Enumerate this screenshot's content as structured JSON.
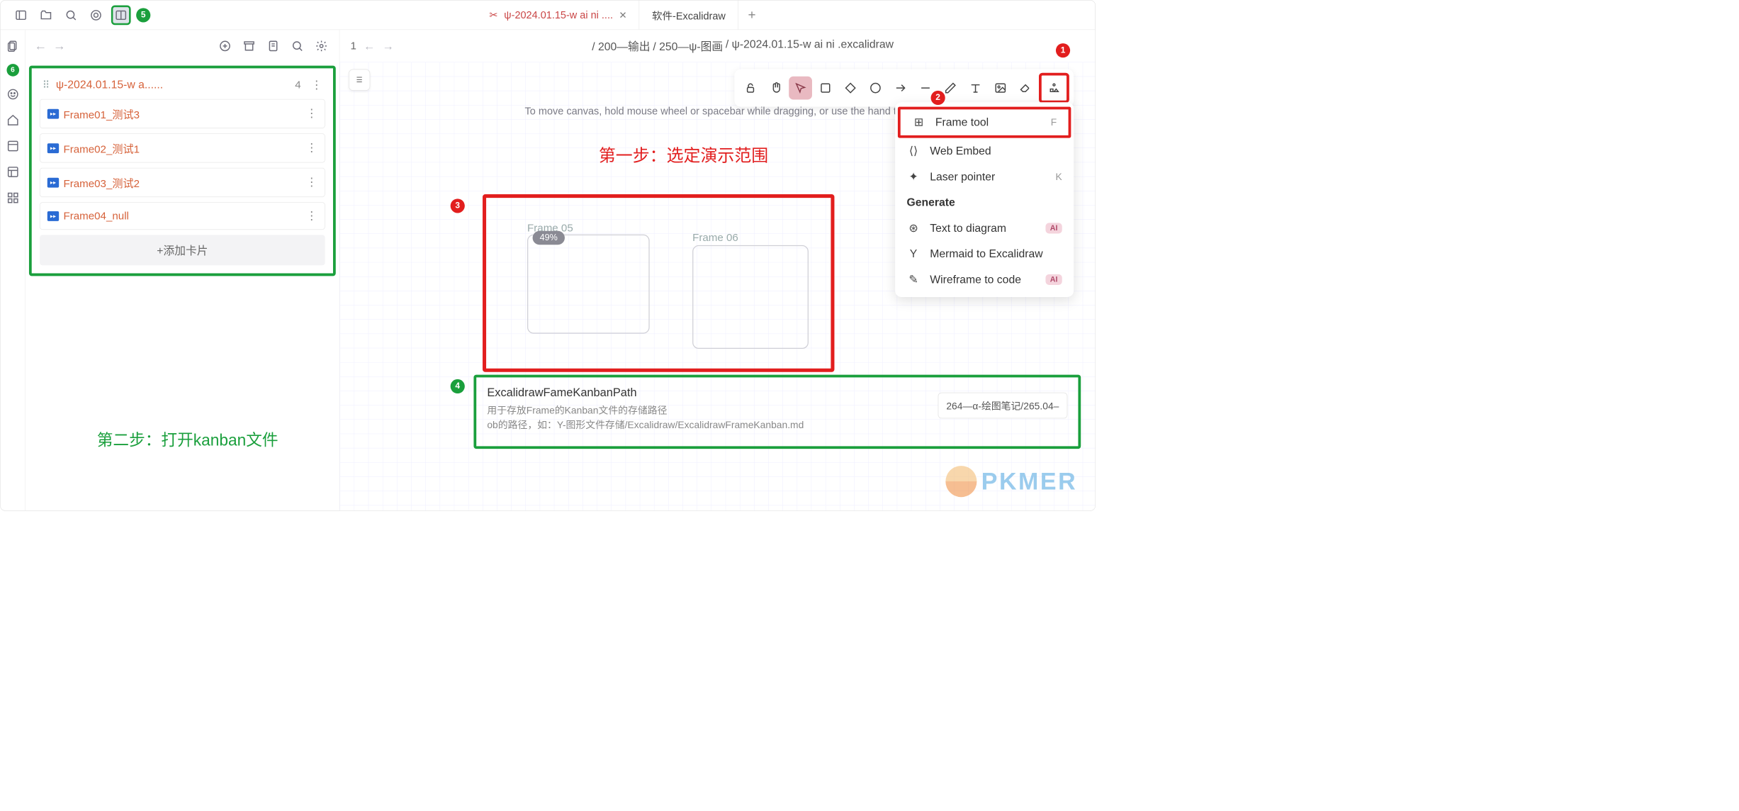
{
  "tabs": {
    "active": "ψ-2024.01.15-w ai ni ....",
    "other": "软件-Excalidraw"
  },
  "sidebar": {
    "badge5": "5",
    "badge6": "6",
    "kanban": {
      "title": "ψ-2024.01.15-w a......",
      "count": "4",
      "cards": [
        {
          "label": "Frame01_测试3"
        },
        {
          "label": "Frame02_测试1"
        },
        {
          "label": "Frame03_测试2"
        },
        {
          "label": "Frame04_null"
        }
      ],
      "add": "+添加卡片"
    },
    "step2": "第二步：打开kanban文件"
  },
  "crumbs": {
    "num": "1",
    "parts": [
      "/  200—输出",
      "/  250—ψ-图画",
      "/  ψ-2024.01.15-w ai ni .excalidraw"
    ]
  },
  "hint": "To move canvas, hold mouse wheel or spacebar while dragging, or use the hand tool",
  "menu": {
    "frame": "Frame tool",
    "frame_key": "F",
    "embed": "Web Embed",
    "laser": "Laser pointer",
    "laser_key": "K",
    "gen": "Generate",
    "ttd": "Text to diagram",
    "mermaid": "Mermaid to Excalidraw",
    "wire": "Wireframe to code",
    "ai": "AI"
  },
  "badges": {
    "b1": "1",
    "b2": "2",
    "b3": "3",
    "b4": "4"
  },
  "step1": "第一步：选定演示范围",
  "frames": {
    "f5": "Frame 05",
    "f6": "Frame 06",
    "pct": "49%"
  },
  "setting": {
    "title": "ExcalidrawFameKanbanPath",
    "desc1": "用于存放Frame的Kanban文件的存储路径",
    "desc2": "ob的路径，如：Y-图形文件存储/Excalidraw/ExcalidrawFrameKanban.md",
    "input": "264—α-绘图笔记/265.04–"
  },
  "watermark": "PKMER"
}
